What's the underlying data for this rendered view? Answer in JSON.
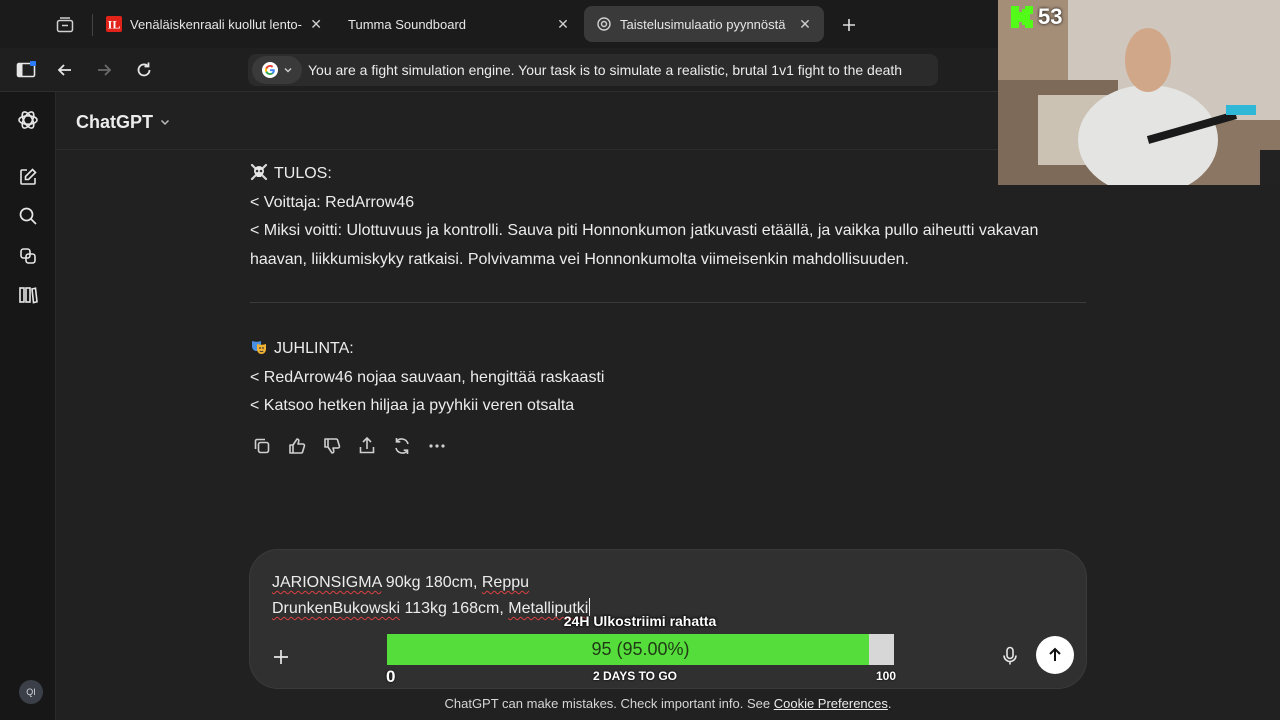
{
  "browser": {
    "tabs": [
      {
        "title": "Venäläiskenraali kuollut lento-onnettomuudessa",
        "active": false,
        "favicon": "il-news-icon"
      },
      {
        "title": "Tumma Soundboard",
        "active": false,
        "favicon": "none"
      },
      {
        "title": "Taistelusimulaatio pyynnöstä",
        "active": true,
        "favicon": "chatgpt-icon"
      }
    ],
    "omnibox_text": "You are a fight simulation engine.  Your task is to simulate a realistic, brutal 1v1 fight to the death"
  },
  "app": {
    "model_name": "ChatGPT",
    "rail_avatar": "QI"
  },
  "messages": {
    "result_heading": "TULOS:",
    "winner_line": "< Voittaja: RedArrow46",
    "reason_line": "< Miksi voitti: Ulottuvuus ja kontrolli. Sauva piti Honnonkumon jatkuvasti etäällä, ja vaikka pullo aiheutti vakavan haavan, liikkumiskyky ratkaisi. Polvivamma vei Honnonkumolta viimeisenkin mahdollisuuden.",
    "celebration_heading": "JUHLINTA:",
    "celebration_line_1": "< RedArrow46 nojaa sauvaan, hengittää raskaasti",
    "celebration_line_2": "< Katsoo hetken hiljaa ja pyyhkii veren otsalta"
  },
  "composer": {
    "line1_name": "JARIONSIGMA",
    "line1_rest": " 90kg 180cm, ",
    "line1_item": "Reppu",
    "line2_name": "DrunkenBukowski",
    "line2_rest": " 113kg 168cm, ",
    "line2_item": "Metalliputki"
  },
  "footer": {
    "disclaimer_text": "ChatGPT can make mistakes. Check important info. See ",
    "disclaimer_link": "Cookie Preferences",
    "disclaimer_end": "."
  },
  "stream_overlay": {
    "goal_title": "24H Ulkostriimi rahatta",
    "goal_value_label": "95 (95.00%)",
    "goal_fraction": 0.95,
    "goal_min": "0",
    "goal_max": "100",
    "goal_sub": "2 DAYS TO GO",
    "goal_fill_color": "#55dd3c",
    "viewer_count": "53",
    "platform_icon": "kick-icon"
  }
}
